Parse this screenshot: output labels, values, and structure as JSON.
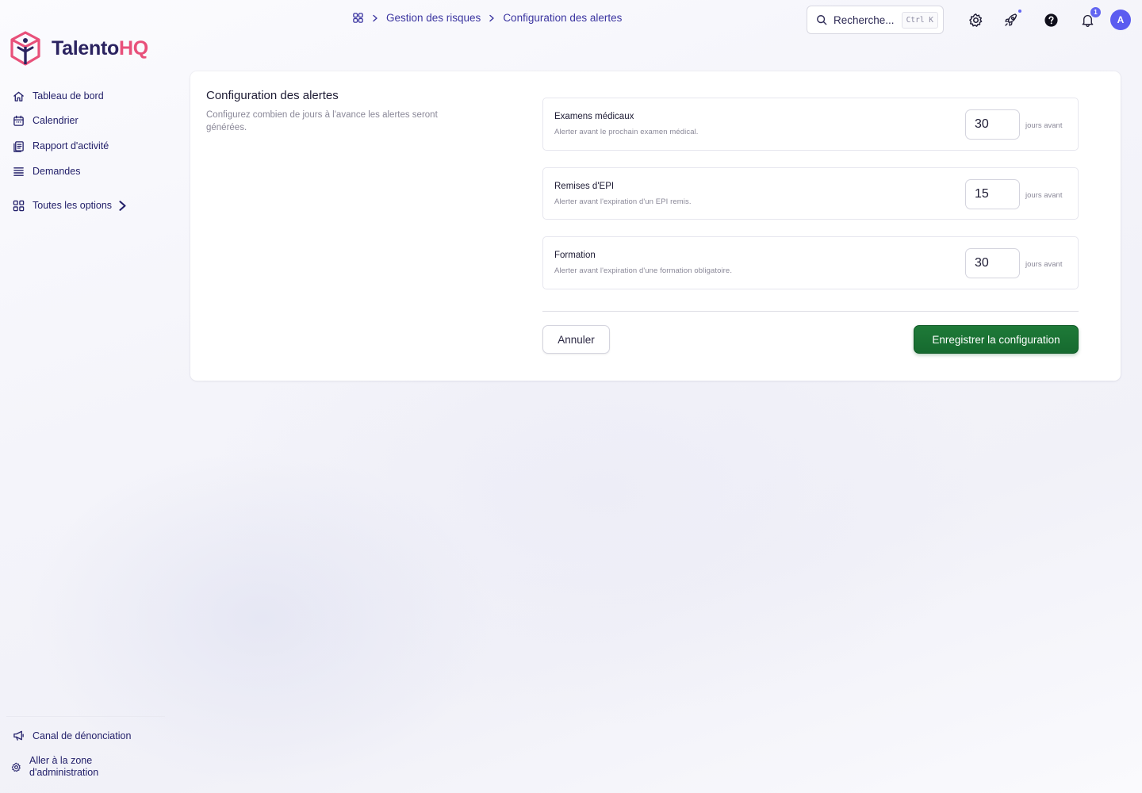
{
  "brand": {
    "name_main": "Talento",
    "name_accent": "HQ",
    "primary_color": "#2b2360",
    "accent_color": "#e8507a"
  },
  "sidebar": {
    "items": [
      {
        "label": "Tableau de bord",
        "icon": "home-icon"
      },
      {
        "label": "Calendrier",
        "icon": "calendar-icon"
      },
      {
        "label": "Rapport d'activité",
        "icon": "report-icon"
      },
      {
        "label": "Demandes",
        "icon": "list-icon"
      },
      {
        "label": "Toutes les options",
        "icon": "grid-icon"
      }
    ],
    "bottom": [
      {
        "label": "Canal de dénonciation",
        "icon": "megaphone-icon"
      },
      {
        "label": "Aller à la zone d'administration",
        "icon": "gear-icon"
      }
    ]
  },
  "breadcrumb": {
    "items": [
      "Gestion des risques",
      "Configuration des alertes"
    ]
  },
  "search": {
    "placeholder": "Recherche...",
    "shortcut": "Ctrl K"
  },
  "notifications": {
    "count": "1"
  },
  "user": {
    "avatar_initial": "A",
    "avatar_color": "#5b5cf0"
  },
  "config": {
    "title": "Configuration des alertes",
    "description": "Configurez combien de jours à l'avance les alertes seront générées.",
    "rows": [
      {
        "title": "Examens médicaux",
        "subtitle": "Alerter avant le prochain examen médical.",
        "value": "30",
        "unit": "jours avant"
      },
      {
        "title": "Remises d'EPI",
        "subtitle": "Alerter avant l'expiration d'un EPI remis.",
        "value": "15",
        "unit": "jours avant"
      },
      {
        "title": "Formation",
        "subtitle": "Alerter avant l'expiration d'une formation obligatoire.",
        "value": "30",
        "unit": "jours avant"
      }
    ],
    "cancel_label": "Annuler",
    "save_label": "Enregistrer la configuration",
    "save_color": "#1e7a38"
  }
}
